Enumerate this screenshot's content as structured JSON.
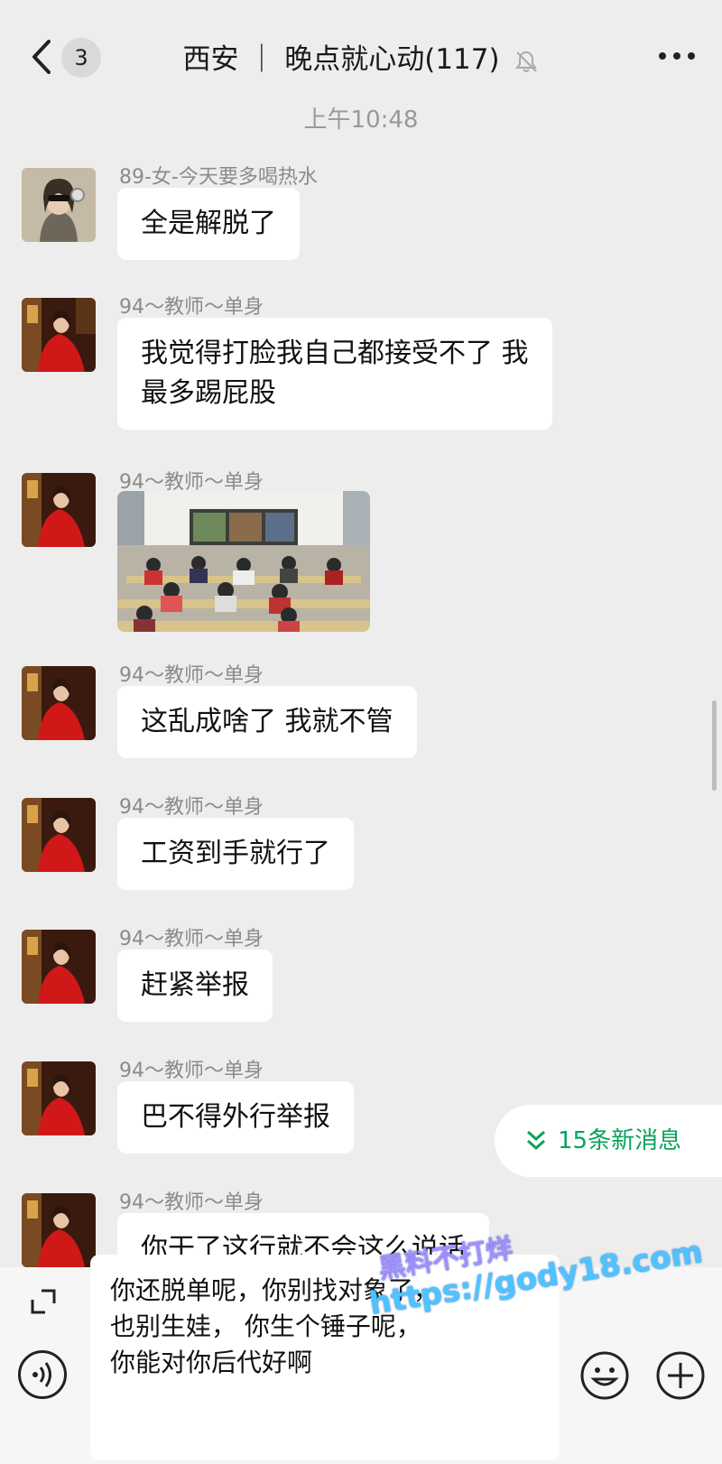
{
  "header": {
    "back_badge": "3",
    "title": "西安 ｜ 晚点就心动(117)"
  },
  "timestamp": "上午10:48",
  "messages": [
    {
      "sender": "89-女-今天要多喝热水",
      "text": "全是解脱了",
      "avatar": "avatar-girl-headphones"
    },
    {
      "sender": "94～教师～单身",
      "text": "我觉得打脸我自己都接受不了 我\n最多踢屁股",
      "avatar": "avatar-red-dress"
    },
    {
      "sender": "94～教师～单身",
      "image": "classroom-photo",
      "avatar": "avatar-red-dress"
    },
    {
      "sender": "94～教师～单身",
      "text": "这乱成啥了 我就不管",
      "avatar": "avatar-red-dress"
    },
    {
      "sender": "94～教师～单身",
      "text": "工资到手就行了",
      "avatar": "avatar-red-dress"
    },
    {
      "sender": "94～教师～单身",
      "text": "赶紧举报",
      "avatar": "avatar-red-dress"
    },
    {
      "sender": "94～教师～单身",
      "text": "巴不得外行举报",
      "avatar": "avatar-red-dress"
    },
    {
      "sender": "94～教师～单身",
      "text": "你干了这行就不会这么说话",
      "avatar": "avatar-red-dress"
    }
  ],
  "new_messages": "15条新消息",
  "input": {
    "text": "你还脱单呢，你别找对象了，\n也别生娃，   你生个锤子呢，\n你能对你后代好啊"
  },
  "watermark": {
    "line1": "黑料不打烊",
    "line2": "https://gody18.com"
  },
  "colors": {
    "background": "#ededed",
    "accent": "#07a35a",
    "bubble": "#ffffff"
  }
}
